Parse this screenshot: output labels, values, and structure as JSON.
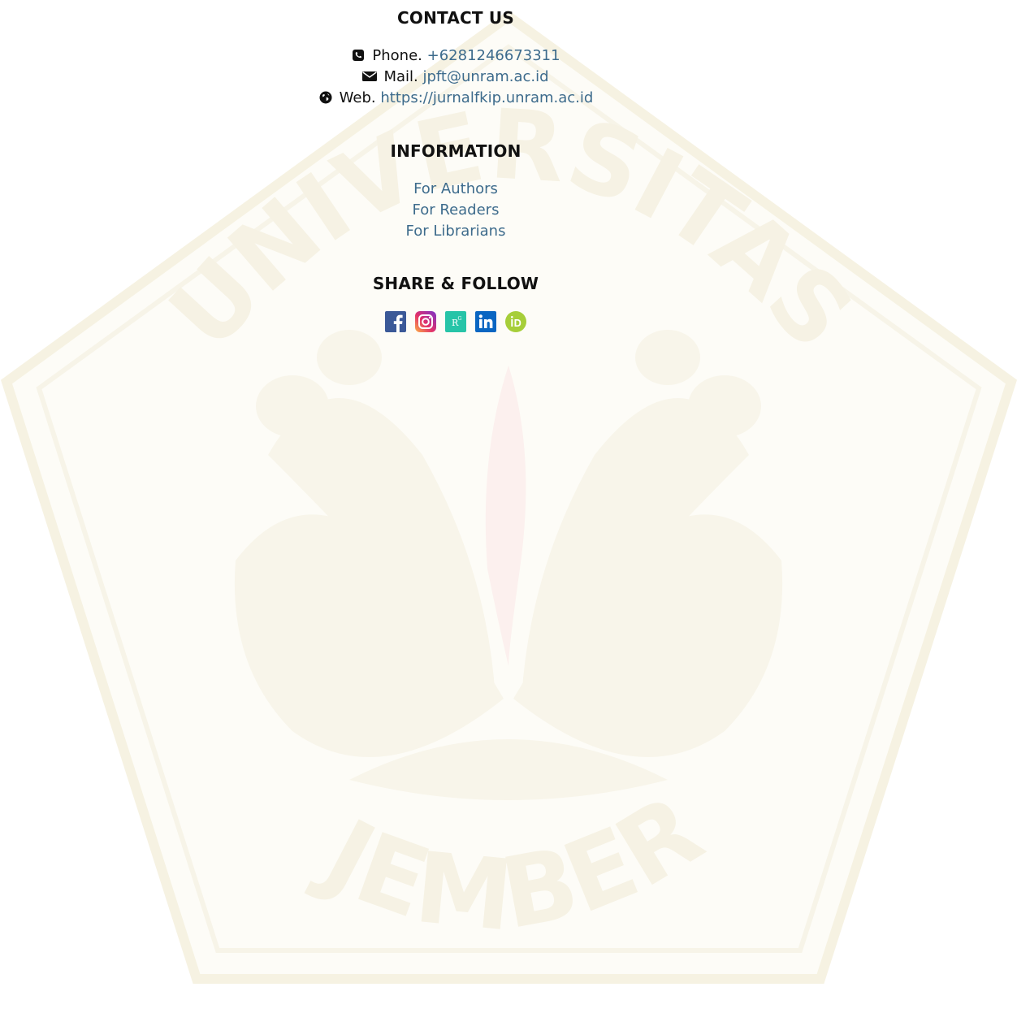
{
  "contact": {
    "title": "CONTACT US",
    "phone_label": "Phone.",
    "phone_value": "+6281246673311",
    "mail_label": "Mail.",
    "mail_value": "jpft@unram.ac.id",
    "web_label": "Web.",
    "web_value": "https://jurnalfkip.unram.ac.id"
  },
  "information": {
    "title": "INFORMATION",
    "links": [
      "For Authors",
      "For Readers",
      "For Librarians"
    ]
  },
  "share": {
    "title": "SHARE & FOLLOW",
    "icons": [
      "facebook-icon",
      "instagram-icon",
      "researchgate-icon",
      "linkedin-icon",
      "orcid-icon"
    ]
  },
  "watermark": {
    "top_text": "UNIVERSITAS",
    "bottom_text": "JEMBER"
  },
  "colors": {
    "link": "#3d6b8c",
    "text": "#111111",
    "watermark": "#f7f3e6"
  }
}
